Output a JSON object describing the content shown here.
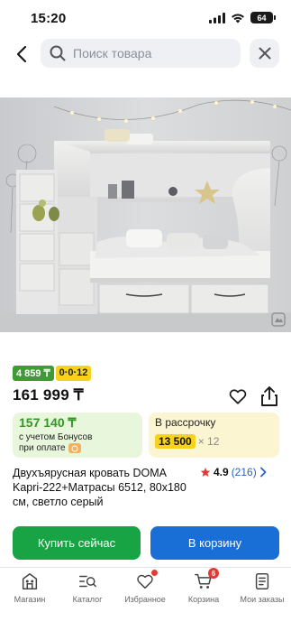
{
  "status": {
    "time": "15:20",
    "battery": "64"
  },
  "search": {
    "placeholder": "Поиск товара"
  },
  "badges": {
    "bonus": "4 859 ₸",
    "installment": "0·0·12"
  },
  "product": {
    "price": "161 999 ₸",
    "title": "Двухъярусная кровать DOMA Kapri-222+Матрасы 6512, 80x180 см, светло серый",
    "rating": "4.9",
    "reviews": "(216)"
  },
  "bonus_card": {
    "price": "157 140 ₸",
    "line1": "с учетом Бонусов",
    "line2": "при оплате"
  },
  "installment_card": {
    "label": "В рассрочку",
    "amount": "13 500",
    "months": "× 12"
  },
  "actions": {
    "buy": "Купить сейчас",
    "cart": "В корзину"
  },
  "tabbar": {
    "items": [
      {
        "label": "Магазин",
        "icon": "store-icon"
      },
      {
        "label": "Каталог",
        "icon": "catalog-search-icon"
      },
      {
        "label": "Избранное",
        "icon": "heart-icon"
      },
      {
        "label": "Корзина",
        "icon": "cart-icon",
        "badge": "6"
      },
      {
        "label": "Мои заказы",
        "icon": "orders-icon"
      }
    ]
  },
  "colors": {
    "bonus_green": "#3f9c35",
    "installment_yellow": "#f7d21c",
    "buy_button": "#18a345",
    "cart_button": "#1a6fd6",
    "notification_red": "#e53935"
  }
}
